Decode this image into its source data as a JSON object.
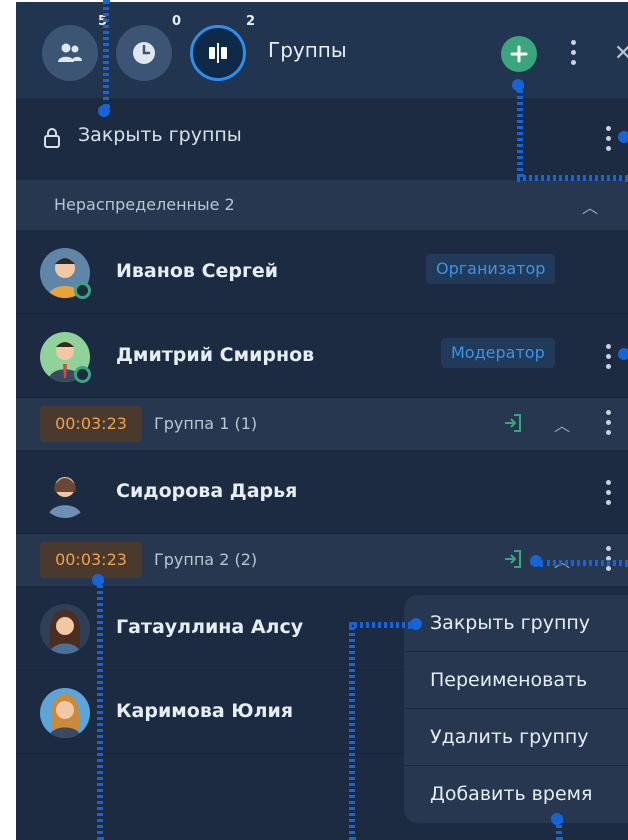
{
  "header": {
    "participants_badge": "5",
    "timer_badge": "0",
    "groups_badge": "2",
    "title": "Группы"
  },
  "close_groups": {
    "label": "Закрыть группы"
  },
  "unassigned": {
    "label": "Нераспределенные 2"
  },
  "people_unassigned": [
    {
      "name": "Иванов Сергей",
      "role": "Организатор"
    },
    {
      "name": "Дмитрий Смирнов",
      "role": "Модератор"
    }
  ],
  "groups": [
    {
      "timer": "00:03:23",
      "name": "Группа 1 (1)",
      "members": [
        "Сидорова Дарья"
      ]
    },
    {
      "timer": "00:03:23",
      "name": "Группа 2 (2)",
      "members": [
        "Гатауллина Алсу",
        "Каримова Юлия"
      ]
    }
  ],
  "context_menu": {
    "items": [
      "Закрыть группу",
      "Переименовать",
      "Удалить группу",
      "Добавить время"
    ]
  },
  "colors": {
    "panel_bg": "#1c2b41",
    "accent_blue": "#2f8ee8",
    "green": "#3aa57f",
    "timer_orange": "#f0a24a",
    "annotation": "#1565d8"
  }
}
